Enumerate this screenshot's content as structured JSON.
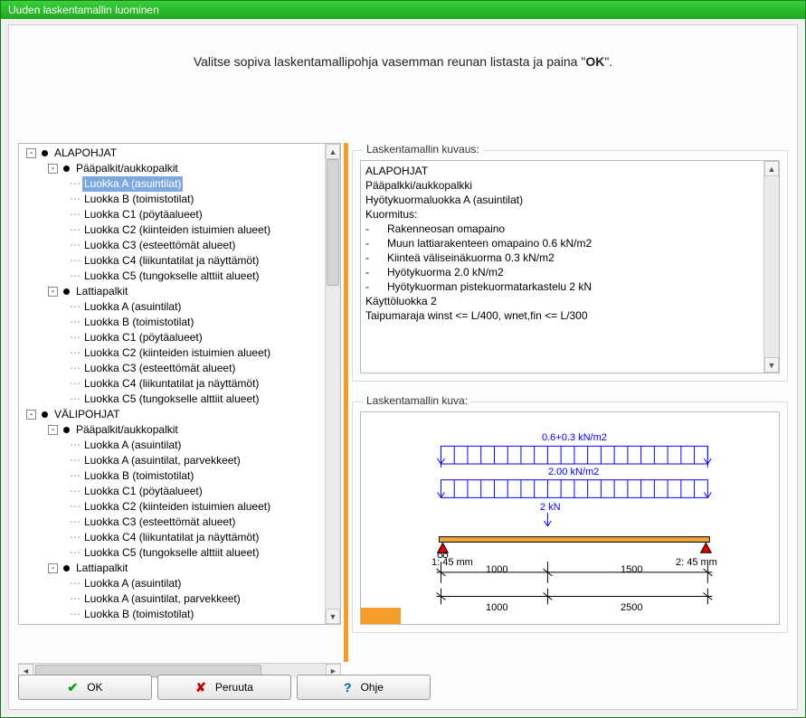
{
  "window": {
    "title": "Uuden laskentamallin luominen"
  },
  "instruction": {
    "prefix": "Valitse sopiva laskentamallipohja vasemman reunan listasta ja paina \"",
    "bold": "OK",
    "suffix": "\"."
  },
  "tree": [
    {
      "level": 0,
      "kind": "branch",
      "exp": "-",
      "label": "ALAPOHJAT"
    },
    {
      "level": 1,
      "kind": "branch",
      "exp": "-",
      "label": "Pääpalkit/aukkopalkit"
    },
    {
      "level": 2,
      "kind": "leaf",
      "label": "Luokka A (asuintilat)",
      "selected": true
    },
    {
      "level": 2,
      "kind": "leaf",
      "label": "Luokka B (toimistotilat)"
    },
    {
      "level": 2,
      "kind": "leaf",
      "label": "Luokka C1 (pöytäalueet)"
    },
    {
      "level": 2,
      "kind": "leaf",
      "label": "Luokka C2 (kiinteiden istuimien alueet)"
    },
    {
      "level": 2,
      "kind": "leaf",
      "label": "Luokka C3 (esteettömät alueet)"
    },
    {
      "level": 2,
      "kind": "leaf",
      "label": "Luokka C4 (liikuntatilat ja näyttämöt)"
    },
    {
      "level": 2,
      "kind": "leaf",
      "label": "Luokka C5 (tungokselle alttiit alueet)"
    },
    {
      "level": 1,
      "kind": "branch",
      "exp": "-",
      "label": "Lattiapalkit"
    },
    {
      "level": 2,
      "kind": "leaf",
      "label": "Luokka A (asuintilat)"
    },
    {
      "level": 2,
      "kind": "leaf",
      "label": "Luokka B (toimistotilat)"
    },
    {
      "level": 2,
      "kind": "leaf",
      "label": "Luokka C1 (pöytäalueet)"
    },
    {
      "level": 2,
      "kind": "leaf",
      "label": "Luokka C2 (kiinteiden istuimien alueet)"
    },
    {
      "level": 2,
      "kind": "leaf",
      "label": "Luokka C3 (esteettömät alueet)"
    },
    {
      "level": 2,
      "kind": "leaf",
      "label": "Luokka C4 (liikuntatilat ja näyttämöt)"
    },
    {
      "level": 2,
      "kind": "leaf",
      "label": "Luokka C5 (tungokselle alttiit alueet)"
    },
    {
      "level": 0,
      "kind": "branch",
      "exp": "-",
      "label": "VÄLIPOHJAT"
    },
    {
      "level": 1,
      "kind": "branch",
      "exp": "-",
      "label": "Pääpalkit/aukkopalkit"
    },
    {
      "level": 2,
      "kind": "leaf",
      "label": "Luokka A (asuintilat)"
    },
    {
      "level": 2,
      "kind": "leaf",
      "label": "Luokka A (asuintilat, parvekkeet)"
    },
    {
      "level": 2,
      "kind": "leaf",
      "label": "Luokka B (toimistotilat)"
    },
    {
      "level": 2,
      "kind": "leaf",
      "label": "Luokka C1 (pöytäalueet)"
    },
    {
      "level": 2,
      "kind": "leaf",
      "label": "Luokka C2 (kiinteiden istuimien alueet)"
    },
    {
      "level": 2,
      "kind": "leaf",
      "label": "Luokka C3 (esteettömät alueet)"
    },
    {
      "level": 2,
      "kind": "leaf",
      "label": "Luokka C4 (liikuntatilat ja näyttämöt)"
    },
    {
      "level": 2,
      "kind": "leaf",
      "label": "Luokka C5 (tungokselle alttiit alueet)"
    },
    {
      "level": 1,
      "kind": "branch",
      "exp": "-",
      "label": "Lattiapalkit"
    },
    {
      "level": 2,
      "kind": "leaf",
      "label": "Luokka A (asuintilat)"
    },
    {
      "level": 2,
      "kind": "leaf",
      "label": "Luokka A (asuintilat, parvekkeet)"
    },
    {
      "level": 2,
      "kind": "leaf",
      "label": "Luokka B (toimistotilat)"
    }
  ],
  "desc": {
    "title": "Laskentamallin kuvaus:",
    "lines": [
      "ALAPOHJAT",
      "Pääpalkki/aukkopalkki",
      "Hyötykuormaluokka A (asuintilat)",
      "Kuormitus:",
      "-      Rakenneosan omapaino",
      "-      Muun lattiarakenteen omapaino 0.6 kN/m2",
      "-      Kiinteä väliseinäkuorma 0.3 kN/m2",
      "-      Hyötykuorma 2.0 kN/m2",
      "-      Hyötykuorman pistekuormatarkastelu 2 kN",
      "Käyttöluokka 2",
      "Taipumaraja winst <= L/400, wnet,fin <= L/300"
    ]
  },
  "kuva": {
    "title": "Laskentamallin kuva:",
    "load1": "0.6+0.3 kN/m2",
    "load2": "2.00 kN/m2",
    "point": "2 kN",
    "left_support": "1: 45 mm",
    "right_support": "2: 45 mm",
    "dim_top_left": "1000",
    "dim_top_right": "1500",
    "dim_bot_left": "1000",
    "dim_bot_right": "2500"
  },
  "buttons": {
    "ok": "OK",
    "cancel": "Peruuta",
    "help": "Ohje"
  }
}
